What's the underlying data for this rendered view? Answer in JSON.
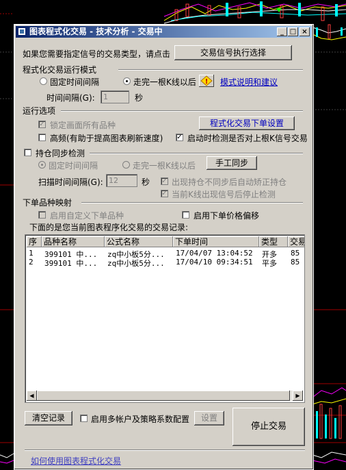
{
  "window": {
    "title": "图表程式化交易 - 技术分析 - 交易中",
    "min_label": "_",
    "max_label": "□",
    "close_label": "×"
  },
  "intro": {
    "text": "如果您需要指定信号的交易类型，请点击",
    "select_button": "交易信号执行选择"
  },
  "mode": {
    "group_label": "程式化交易运行模式",
    "fixed_interval": "固定时间间隔",
    "after_bar": "走完一根K线以后",
    "help_link": "模式说明和建议",
    "interval_label": "时间间隔(G):",
    "interval_value": "1",
    "interval_unit": "秒"
  },
  "options": {
    "group_label": "运行选项",
    "lock_label": "锁定画面所有品种",
    "order_settings_button": "程式化交易下单设置",
    "high_freq_label": "高频(有助于提高图表刷新速度)",
    "startup_check_label": "启动时检测是否对上根K信号交易"
  },
  "sync": {
    "group_label": "持仓同步检测",
    "fixed_interval": "固定时间间隔",
    "after_bar": "走完一根K线以后",
    "manual_button": "手工同步",
    "scan_label": "扫描时间间隔(G):",
    "scan_value": "12",
    "scan_unit": "秒",
    "auto_correct": "出现持仓不同步后自动矫正持仓",
    "stop_on_signal": "当前K线出现信号后停止检测"
  },
  "mapping": {
    "group_label": "下单品种映射",
    "custom_label": "启用自定义下单品种",
    "price_offset_label": "启用下单价格偏移",
    "records_caption": "下面的是您当前图表程序化交易的交易记录:"
  },
  "records": {
    "columns": [
      "序",
      "品种名称",
      "公式名称",
      "下单时间",
      "类型",
      "交易"
    ],
    "rows": [
      [
        "1",
        "399101 中...",
        "zq中小板5分...",
        "17/04/07 13:04:52",
        "开多",
        "85"
      ],
      [
        "2",
        "399101 中...",
        "zq中小板5分...",
        "17/04/10 09:34:51",
        "平多",
        "85"
      ]
    ]
  },
  "footer": {
    "clear_button": "清空记录",
    "multi_account_label": "启用多帐户及策略系数配置",
    "settings_button": "设置",
    "stop_button": "停止交易",
    "help_link": "如何使用图表程式化交易"
  },
  "colors": {
    "title_start": "#0a246a",
    "title_end": "#a6caf0",
    "dialog_bg": "#d4d0c8",
    "link": "#0000c0"
  }
}
